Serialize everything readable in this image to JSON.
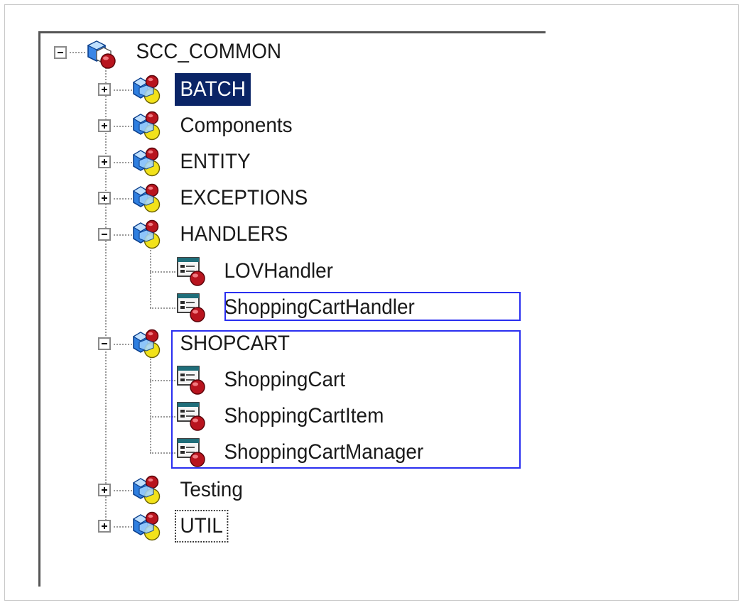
{
  "tree": {
    "root": {
      "label": "SCC_COMMON",
      "state": "expanded",
      "icon": "project-package-icon"
    },
    "nodes": [
      {
        "label": "BATCH",
        "state": "collapsed",
        "selected": true,
        "icon": "folder-package-icon"
      },
      {
        "label": "Components",
        "state": "collapsed",
        "icon": "folder-package-icon"
      },
      {
        "label": "ENTITY",
        "state": "collapsed",
        "icon": "folder-package-icon"
      },
      {
        "label": "EXCEPTIONS",
        "state": "collapsed",
        "icon": "folder-package-icon"
      },
      {
        "label": "HANDLERS",
        "state": "expanded",
        "icon": "folder-package-icon",
        "children": [
          {
            "label": "LOVHandler",
            "icon": "class-icon"
          },
          {
            "label": "ShoppingCartHandler",
            "icon": "class-icon",
            "highlighted": true
          }
        ]
      },
      {
        "label": "SHOPCART",
        "state": "expanded",
        "icon": "folder-package-icon",
        "highlighted": true,
        "children": [
          {
            "label": "ShoppingCart",
            "icon": "class-icon"
          },
          {
            "label": "ShoppingCartItem",
            "icon": "class-icon"
          },
          {
            "label": "ShoppingCartManager",
            "icon": "class-icon"
          }
        ]
      },
      {
        "label": "Testing",
        "state": "collapsed",
        "icon": "folder-package-icon"
      },
      {
        "label": "UTIL",
        "state": "collapsed",
        "focused": true,
        "icon": "folder-package-icon"
      }
    ]
  },
  "colors": {
    "selection_background": "#0a2466",
    "highlight_border": "#2a2ff0",
    "package_blue": "#2f7fe0",
    "package_yellow": "#f2e21a",
    "package_red": "#b8141e"
  }
}
